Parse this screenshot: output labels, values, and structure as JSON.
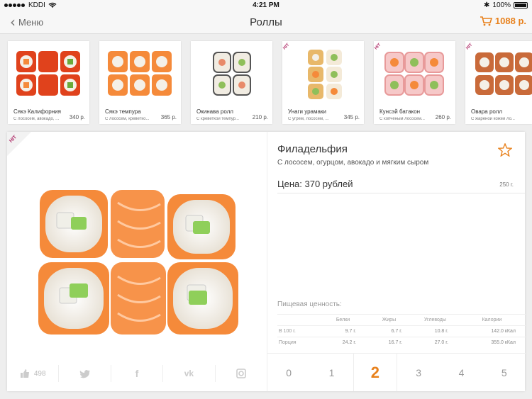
{
  "status": {
    "carrier": "KDDI",
    "time": "4:21 PM",
    "battery": "100%"
  },
  "nav": {
    "back_label": "Меню",
    "title": "Роллы",
    "cart_total": "1088 р."
  },
  "products": [
    {
      "name": "Сякэ Калифорния",
      "desc": "С лососем, авокадо, ...",
      "price": "340 р.",
      "hit": false
    },
    {
      "name": "Сякэ темпура",
      "desc": "С лососем, креветко...",
      "price": "365 р.",
      "hit": false
    },
    {
      "name": "Окинава ролл",
      "desc": "С креветкой темпур...",
      "price": "210 р.",
      "hit": false
    },
    {
      "name": "Унаги урамаки",
      "desc": "С угрём, лососем, ...",
      "price": "345 р.",
      "hit": true
    },
    {
      "name": "Кунсэй батакон",
      "desc": "С копчёным лососем...",
      "price": "260 р.",
      "hit": true
    },
    {
      "name": "Овара ролл",
      "desc": "С жареной кожей ло...",
      "price": "",
      "hit": true
    }
  ],
  "hit_label": "HIT",
  "detail": {
    "title": "Филадельфия",
    "subtitle": "С лососем, огурцом, авокадо и мягким сыром",
    "price_line": "Цена: 370 рублей",
    "weight": "250 г.",
    "likes": "498",
    "nutrition": {
      "title": "Пищевая ценность:",
      "columns": [
        "Белки",
        "Жиры",
        "Углеводы",
        "Калории"
      ],
      "rows": [
        {
          "label": "В 100 г.",
          "values": [
            "9.7 г.",
            "6.7 г.",
            "10.8 г.",
            "142.0 кКал"
          ]
        },
        {
          "label": "Порция",
          "values": [
            "24.2 г.",
            "16.7 г.",
            "27.0 г.",
            "355.0 кКал"
          ]
        }
      ]
    },
    "quantities": [
      "0",
      "1",
      "2",
      "3",
      "4",
      "5"
    ],
    "selected_quantity": "2"
  },
  "colors": {
    "accent": "#e8811c",
    "hit": "#b0306a",
    "salmon": "#f58a3a"
  },
  "icons": [
    "chevron-left-icon",
    "cart-icon",
    "star-icon",
    "like-icon",
    "twitter-icon",
    "facebook-icon",
    "vk-icon",
    "instagram-icon"
  ]
}
